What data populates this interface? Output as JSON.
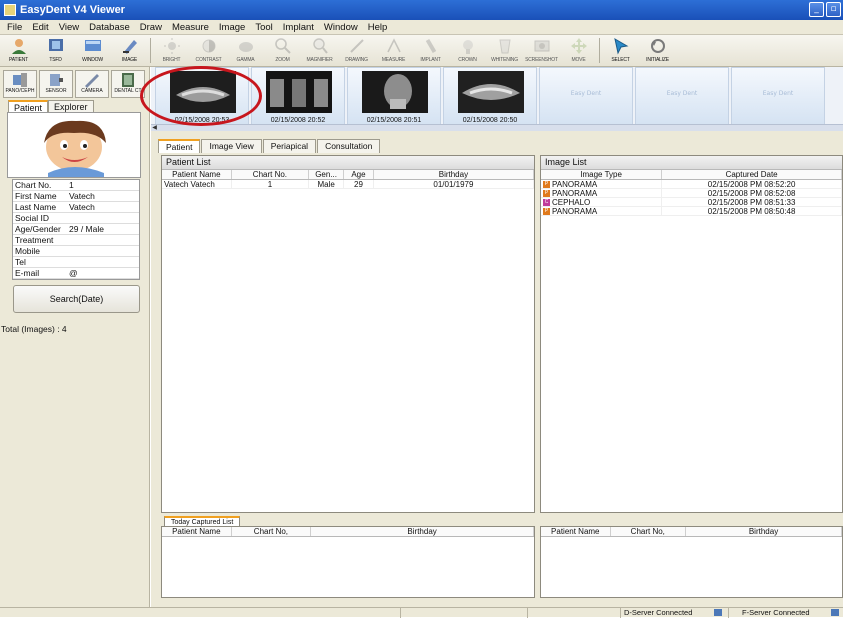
{
  "window": {
    "title": "EasyDent V4 Viewer"
  },
  "menu": [
    "File",
    "Edit",
    "View",
    "Database",
    "Draw",
    "Measure",
    "Image",
    "Tool",
    "Implant",
    "Window",
    "Help"
  ],
  "toolbar": [
    {
      "label": "PATIENT",
      "icon": "patient-icon"
    },
    {
      "label": "TSFD",
      "icon": "tsfd-icon"
    },
    {
      "label": "WINDOW",
      "icon": "window-icon"
    },
    {
      "label": "IMAGE",
      "icon": "image-icon"
    },
    {
      "label": "BRIGHT",
      "icon": "bright-icon"
    },
    {
      "label": "CONTRAST",
      "icon": "contrast-icon"
    },
    {
      "label": "GAMMA",
      "icon": "gamma-icon"
    },
    {
      "label": "ZOOM",
      "icon": "zoom-icon"
    },
    {
      "label": "MAGNIFIER",
      "icon": "magnifier-icon"
    },
    {
      "label": "DRAWING",
      "icon": "drawing-icon"
    },
    {
      "label": "MEASURE",
      "icon": "measure-icon"
    },
    {
      "label": "IMPLANT",
      "icon": "implant-icon"
    },
    {
      "label": "CROWN",
      "icon": "crown-icon"
    },
    {
      "label": "WHITENING",
      "icon": "whitening-icon"
    },
    {
      "label": "SCREENSHOT",
      "icon": "screenshot-icon"
    },
    {
      "label": "MOVE",
      "icon": "move-icon"
    },
    {
      "label": "SELECT",
      "icon": "select-icon"
    },
    {
      "label": "INITIALIZE",
      "icon": "initialize-icon"
    }
  ],
  "left": {
    "sources": [
      {
        "label": "PANO/CEPH",
        "icon": "pano-ceph-icon"
      },
      {
        "label": "SENSOR",
        "icon": "sensor-icon"
      },
      {
        "label": "CAMERA",
        "icon": "camera-icon"
      },
      {
        "label": "DENTAL CT",
        "icon": "dental-ct-icon"
      }
    ],
    "tabs": [
      "Patient",
      "Explorer"
    ],
    "info": [
      {
        "k": "Chart No.",
        "v": "1"
      },
      {
        "k": "First Name",
        "v": "Vatech"
      },
      {
        "k": "Last Name",
        "v": "Vatech"
      },
      {
        "k": "Social ID",
        "v": ""
      },
      {
        "k": "Age/Gender",
        "v": "29 / Male"
      },
      {
        "k": "Treatment",
        "v": ""
      },
      {
        "k": "Mobile",
        "v": ""
      },
      {
        "k": "Tel",
        "v": ""
      },
      {
        "k": "E-mail",
        "v": "@"
      }
    ],
    "search_label": "Search(Date)",
    "total": "Total (Images) : 4"
  },
  "thumbnails": [
    {
      "caption": "02/15/2008 20:53",
      "type": "panorama"
    },
    {
      "caption": "02/15/2008 20:52",
      "type": "panorama"
    },
    {
      "caption": "02/15/2008 20:51",
      "type": "cephalo"
    },
    {
      "caption": "02/15/2008 20:50",
      "type": "panorama"
    },
    {
      "caption": "",
      "placeholder": "Easy Dent"
    },
    {
      "caption": "",
      "placeholder": "Easy Dent"
    },
    {
      "caption": "",
      "placeholder": "Easy Dent"
    }
  ],
  "main_tabs": [
    "Patient",
    "Image View",
    "Periapical",
    "Consultation"
  ],
  "patient_list": {
    "title": "Patient List",
    "columns": [
      "Patient Name",
      "Chart No.",
      "Gen...",
      "Age",
      "Birthday"
    ],
    "rows": [
      [
        "Vatech Vatech",
        "1",
        "Male",
        "29",
        "01/01/1979"
      ]
    ]
  },
  "image_list": {
    "title": "Image List",
    "columns": [
      "Image Type",
      "Captured Date"
    ],
    "rows": [
      {
        "badge": "P",
        "badge_color": "#e07a1c",
        "type": "PANORAMA",
        "date": "02/15/2008 PM 08:52:20"
      },
      {
        "badge": "P",
        "badge_color": "#e07a1c",
        "type": "PANORAMA",
        "date": "02/15/2008 PM 08:52:08"
      },
      {
        "badge": "C",
        "badge_color": "#c03c9a",
        "type": "CEPHALO",
        "date": "02/15/2008 PM 08:51:33"
      },
      {
        "badge": "P",
        "badge_color": "#e07a1c",
        "type": "PANORAMA",
        "date": "02/15/2008 PM 08:50:48"
      }
    ]
  },
  "today_captured": {
    "tab": "Today Captured List",
    "columns": [
      "Patient Name",
      "Chart No,",
      "Birthday"
    ]
  },
  "right_bottom": {
    "columns": [
      "Patient Name",
      "Chart No,",
      "Birthday"
    ]
  },
  "status": {
    "d_server": "D-Server Connected",
    "f_server": "F-Server Connected"
  },
  "colors": {
    "highlight": "#c7161d",
    "tab_accent": "#f0a020",
    "titlebar": "#1f5bc4"
  }
}
